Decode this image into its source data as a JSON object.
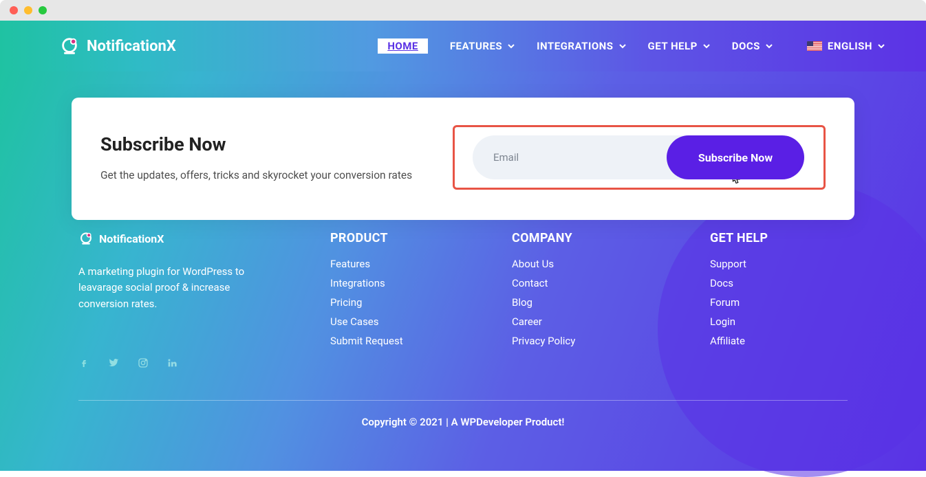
{
  "brand": "NotificationX",
  "nav": {
    "home": "HOME",
    "features": "FEATURES",
    "integrations": "INTEGRATIONS",
    "gethelp": "GET HELP",
    "docs": "DOCS",
    "language": "ENGLISH"
  },
  "subscribe": {
    "title": "Subscribe Now",
    "subtitle": "Get the updates, offers, tricks and skyrocket your conversion rates",
    "email_placeholder": "Email",
    "button": "Subscribe Now"
  },
  "footer": {
    "brand": "NotificationX",
    "desc": "A marketing plugin for WordPress to leavarage social proof & increase conversion rates.",
    "product_title": "PRODUCT",
    "product": {
      "features": "Features",
      "integrations": "Integrations",
      "pricing": "Pricing",
      "usecases": "Use Cases",
      "submit": "Submit Request"
    },
    "company_title": "COMPANY",
    "company": {
      "about": "About Us",
      "contact": "Contact",
      "blog": "Blog",
      "career": "Career",
      "privacy": "Privacy Policy"
    },
    "gethelp_title": "GET HELP",
    "gethelp": {
      "support": "Support",
      "docs": "Docs",
      "forum": "Forum",
      "login": "Login",
      "affiliate": "Affiliate"
    },
    "copyright": "Copyright © 2021 | A WPDeveloper Product!"
  }
}
